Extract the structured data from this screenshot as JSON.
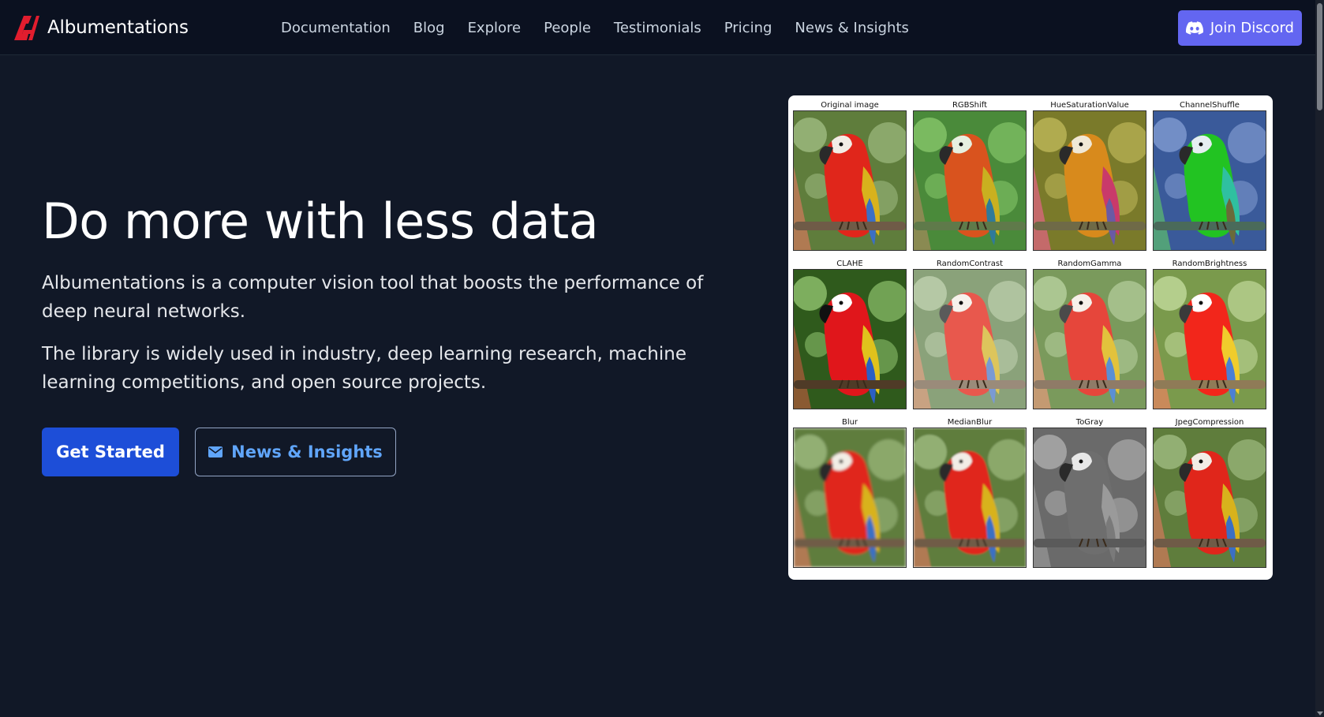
{
  "brand": {
    "name": "Albumentations",
    "logo_color": "#e11d2e"
  },
  "nav": {
    "links": [
      "Documentation",
      "Blog",
      "Explore",
      "People",
      "Testimonials",
      "Pricing",
      "News & Insights"
    ],
    "cta_label": "Join Discord",
    "cta_color": "#6366f1"
  },
  "hero": {
    "title": "Do more with less data",
    "paragraph1": "Albumentations is a computer vision tool that boosts the performance of deep neural networks.",
    "paragraph2": "The library is widely used in industry, deep learning research, machine learning competitions, and open source projects.",
    "primary_button": "Get Started",
    "secondary_button": "News & Insights",
    "primary_color": "#1d4ed8",
    "secondary_text_color": "#60a5fa"
  },
  "figure": {
    "cells": [
      {
        "label": "Original image",
        "filter": "original"
      },
      {
        "label": "RGBShift",
        "filter": "rgbshift"
      },
      {
        "label": "HueSaturationValue",
        "filter": "hsv"
      },
      {
        "label": "ChannelShuffle",
        "filter": "channelshuffle"
      },
      {
        "label": "CLAHE",
        "filter": "clahe"
      },
      {
        "label": "RandomContrast",
        "filter": "contrast"
      },
      {
        "label": "RandomGamma",
        "filter": "gamma"
      },
      {
        "label": "RandomBrightness",
        "filter": "brightness"
      },
      {
        "label": "Blur",
        "filter": "blur"
      },
      {
        "label": "MedianBlur",
        "filter": "medianblur"
      },
      {
        "label": "ToGray",
        "filter": "gray"
      },
      {
        "label": "JpegCompression",
        "filter": "jpeg"
      }
    ]
  }
}
